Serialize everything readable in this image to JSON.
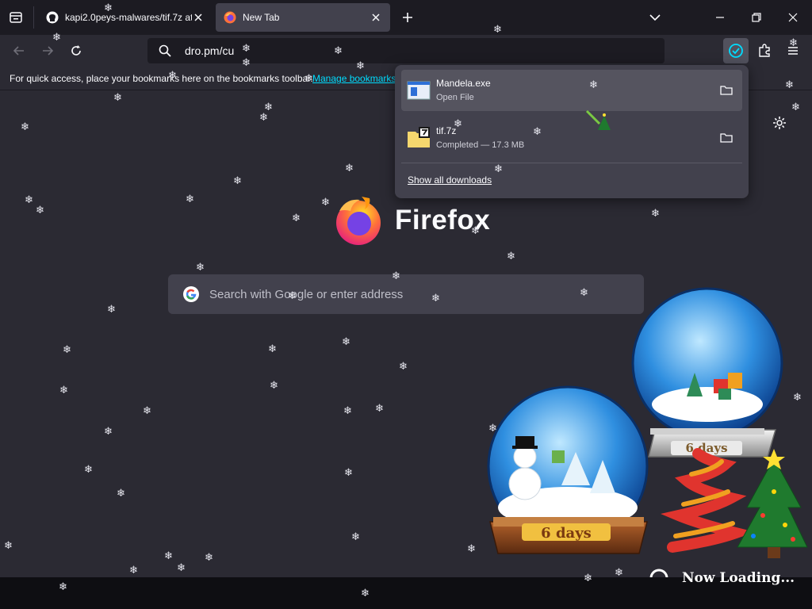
{
  "tabs": [
    {
      "title": "kapi2.0peys-malwares/tif.7z at",
      "favicon": "github-icon",
      "active": false
    },
    {
      "title": "New Tab",
      "favicon": "firefox-icon",
      "active": true
    }
  ],
  "url": "dro.pm/cu",
  "bookmarks": {
    "message": "For quick access, place your bookmarks here on the bookmarks toolbar.",
    "link": "Manage bookmarks"
  },
  "brand": "Firefox",
  "search": {
    "placeholder": "Search with Google or enter address"
  },
  "downloads": {
    "items": [
      {
        "name": "Mandela.exe",
        "status": "Open File",
        "icon": "exe-icon"
      },
      {
        "name": "tif.7z",
        "status": "Completed — 17.3 MB",
        "icon": "archive-icon"
      }
    ],
    "show_all": "Show all downloads"
  },
  "decorations": {
    "globe_left_label": "6 days",
    "globe_right_label": "6 days",
    "loading_text": "Now Loading..."
  },
  "colors": {
    "accent": "#00ddff",
    "background": "#2b2a33",
    "toolbar": "#1c1b22"
  }
}
